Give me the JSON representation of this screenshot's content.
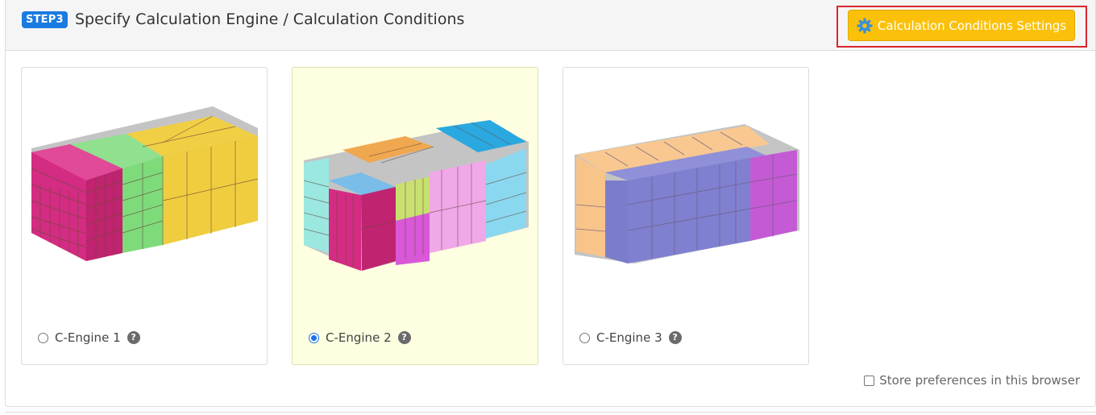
{
  "header": {
    "step_badge": "STEP3",
    "title": "Specify Calculation Engine / Calculation Conditions",
    "settings_button_label": "Calculation Conditions Settings"
  },
  "engines": [
    {
      "label": "C-Engine 1",
      "selected": false
    },
    {
      "label": "C-Engine 2",
      "selected": true
    },
    {
      "label": "C-Engine 3",
      "selected": false
    }
  ],
  "store_preferences": {
    "label": "Store preferences in this browser",
    "checked": false
  },
  "colors": {
    "badge": "#1a7be0",
    "button": "#fbc10a",
    "highlight": "#d9262e",
    "selected_card": "#fefee0",
    "radio_selected": "#1a73e8"
  },
  "icons": [
    "gear-icon",
    "help-icon",
    "radio-icon",
    "checkbox-icon"
  ]
}
